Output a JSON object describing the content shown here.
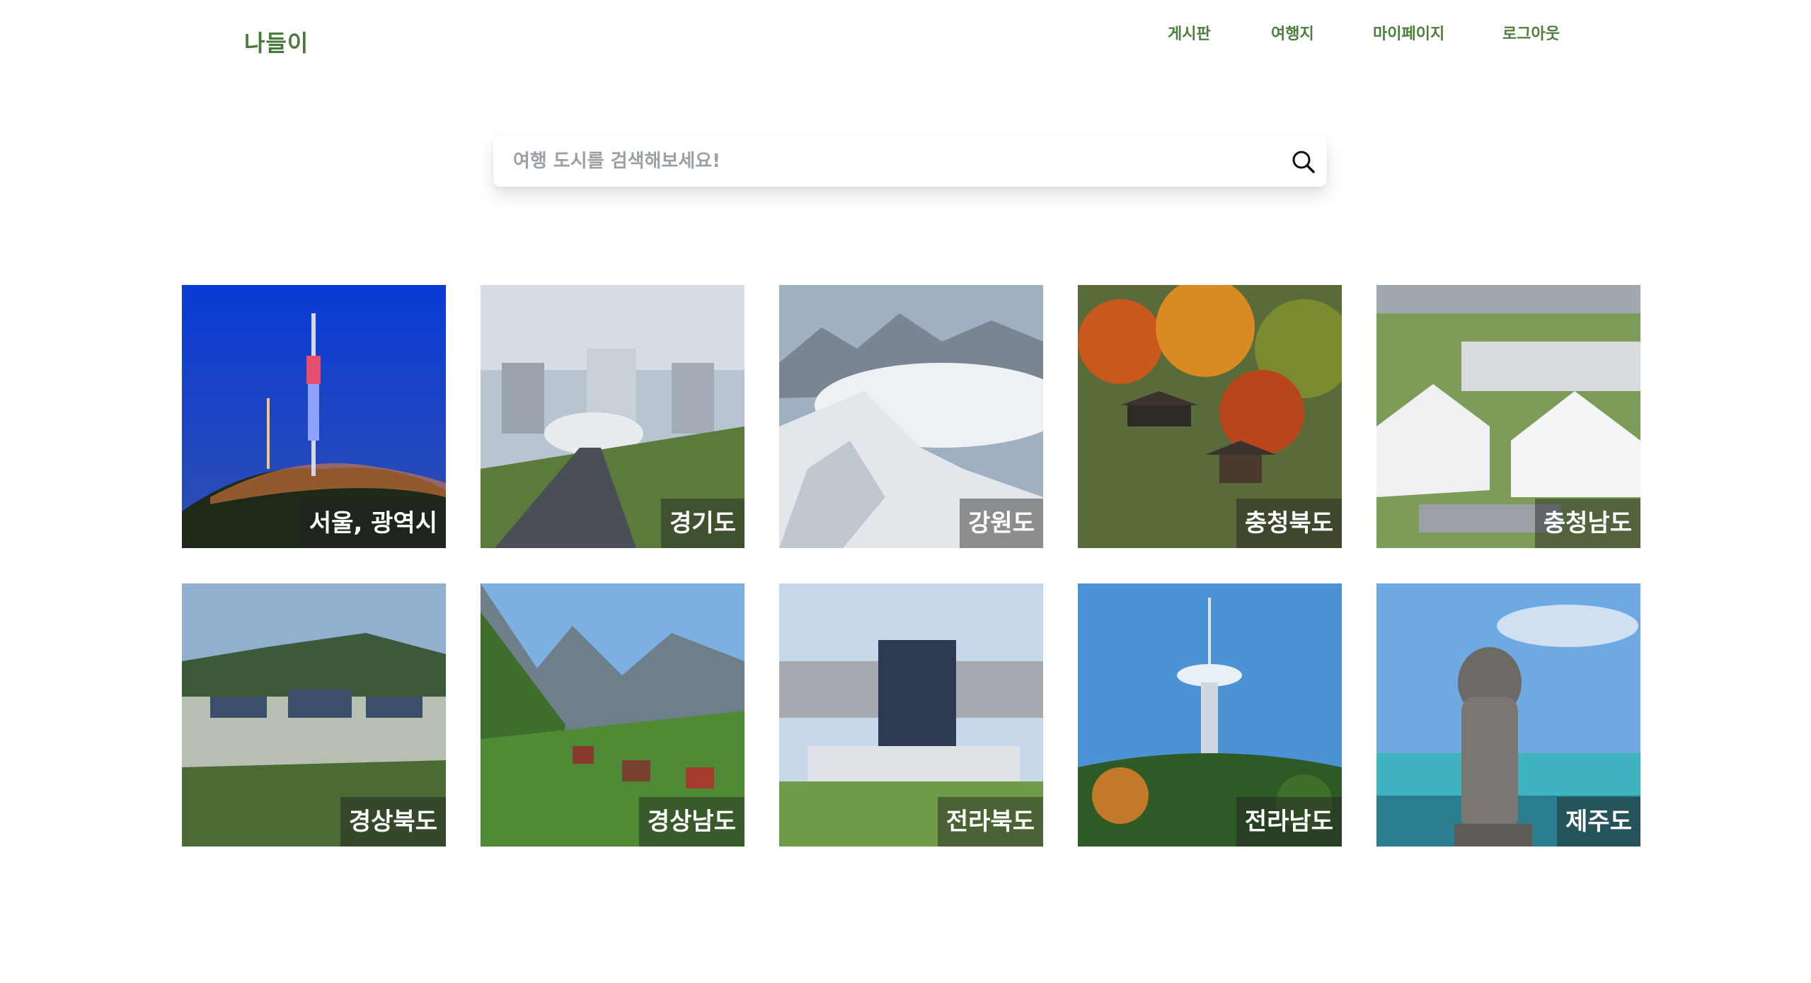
{
  "header": {
    "logo": "나들이",
    "nav": [
      {
        "label": "게시판"
      },
      {
        "label": "여행지"
      },
      {
        "label": "마이페이지"
      },
      {
        "label": "로그아웃"
      }
    ]
  },
  "search": {
    "placeholder": "여행 도시를 검색해보세요!",
    "icon": "search-icon"
  },
  "regions": [
    {
      "label": "서울, 광역시"
    },
    {
      "label": "경기도"
    },
    {
      "label": "강원도"
    },
    {
      "label": "충청북도"
    },
    {
      "label": "충청남도"
    },
    {
      "label": "경상북도"
    },
    {
      "label": "경상남도"
    },
    {
      "label": "전라북도"
    },
    {
      "label": "전라남도"
    },
    {
      "label": "제주도"
    }
  ],
  "colors": {
    "brand": "#4d7f3c",
    "label_overlay": "#1e1e1e"
  }
}
